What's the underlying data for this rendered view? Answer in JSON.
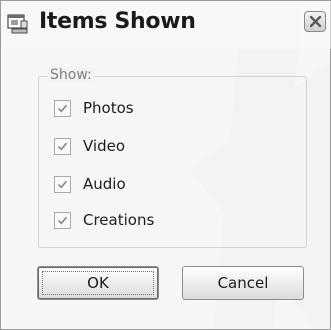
{
  "window": {
    "title": "Items Shown",
    "icon": "dialog-window-icon",
    "close_icon": "close-icon"
  },
  "group": {
    "legend": "Show:"
  },
  "options": [
    {
      "label": "Photos",
      "checked": true
    },
    {
      "label": "Video",
      "checked": true
    },
    {
      "label": "Audio",
      "checked": true
    },
    {
      "label": "Creations",
      "checked": true
    }
  ],
  "buttons": {
    "ok": "OK",
    "cancel": "Cancel"
  },
  "colors": {
    "check_mark": "#8a8a8a",
    "close_x": "#5a5a5a"
  }
}
